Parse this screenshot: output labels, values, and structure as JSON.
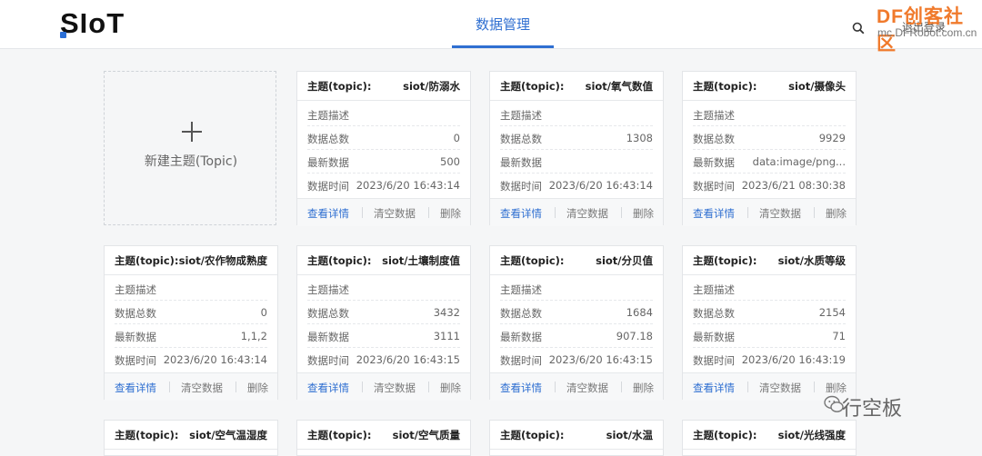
{
  "header": {
    "logo": "SIoT",
    "nav_tab": "数据管理",
    "logout": "退出登录",
    "accent": "#2f6fd1"
  },
  "watermark": {
    "brand": "DF创客社区",
    "url": "mc.DFRobot.com.cn",
    "bottom": "行空板"
  },
  "new_topic": {
    "plus": "+",
    "label": "新建主题(Topic)"
  },
  "card_labels": {
    "topic_key": "主题(topic):",
    "desc": "主题描述",
    "count": "数据总数",
    "latest": "最新数据",
    "time": "数据时间",
    "view": "查看详情",
    "clear": "清空数据",
    "delete": "删除"
  },
  "cards": [
    {
      "topic": "siot/防溺水",
      "desc": "",
      "count": "0",
      "latest": "500",
      "time": "2023/6/20 16:43:14"
    },
    {
      "topic": "siot/氧气数值",
      "desc": "",
      "count": "1308",
      "latest": "",
      "time": "2023/6/20 16:43:14"
    },
    {
      "topic": "siot/摄像头",
      "desc": "",
      "count": "9929",
      "latest": "data:image/png...",
      "time": "2023/6/21 08:30:38"
    },
    {
      "topic": "siot/农作物成熟度",
      "desc": "",
      "count": "0",
      "latest": "1,1,2",
      "time": "2023/6/20 16:43:14"
    },
    {
      "topic": "siot/土壤制度值",
      "desc": "",
      "count": "3432",
      "latest": "3111",
      "time": "2023/6/20 16:43:15"
    },
    {
      "topic": "siot/分贝值",
      "desc": "",
      "count": "1684",
      "latest": "907.18",
      "time": "2023/6/20 16:43:15"
    },
    {
      "topic": "siot/水质等级",
      "desc": "",
      "count": "2154",
      "latest": "71",
      "time": "2023/6/20 16:43:19"
    },
    {
      "topic": "siot/空气温湿度"
    },
    {
      "topic": "siot/空气质量"
    },
    {
      "topic": "siot/水温"
    },
    {
      "topic": "siot/光线强度"
    }
  ]
}
